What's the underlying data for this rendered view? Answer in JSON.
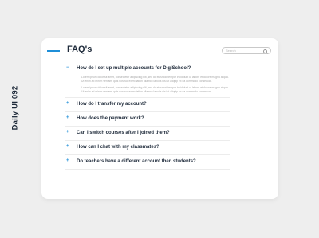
{
  "side_label": "Daily UI 092",
  "header": {
    "title": "FAQ's",
    "accent_color": "#1f8fd8"
  },
  "search": {
    "placeholder": "Search",
    "icon": "search-icon"
  },
  "faqs": [
    {
      "toggle": "−",
      "question": "How do I set up multiple accounts for DigiSchool?",
      "answer": [
        "Lorem ipsum dolor sit amet, consectetur adipiscing elit, sed do eiusmod tempor incididunt ut labore et dolore magna aliqua. Ut enim ad minim veniam, quis nostrud exercitation ullamco laboris nisi ut aliquip ex ea commodo consequat.",
        "Lorem ipsum dolor sit amet, consectetur adipiscing elit, sed do eiusmod tempor incididunt ut labore et dolore magna aliqua. Ut enim ad minim veniam, quis nostrud exercitation ullamco laboris nisi ut aliquip ex ea commodo consequat."
      ]
    },
    {
      "toggle": "+",
      "question": "How do I transfer my account?"
    },
    {
      "toggle": "+",
      "question": "How does the payment work?"
    },
    {
      "toggle": "+",
      "question": "Can I switch courses after I joined them?"
    },
    {
      "toggle": "+",
      "question": "How can I chat with my classmates?"
    },
    {
      "toggle": "+",
      "question": "Do teachers have a different account then students?"
    }
  ]
}
